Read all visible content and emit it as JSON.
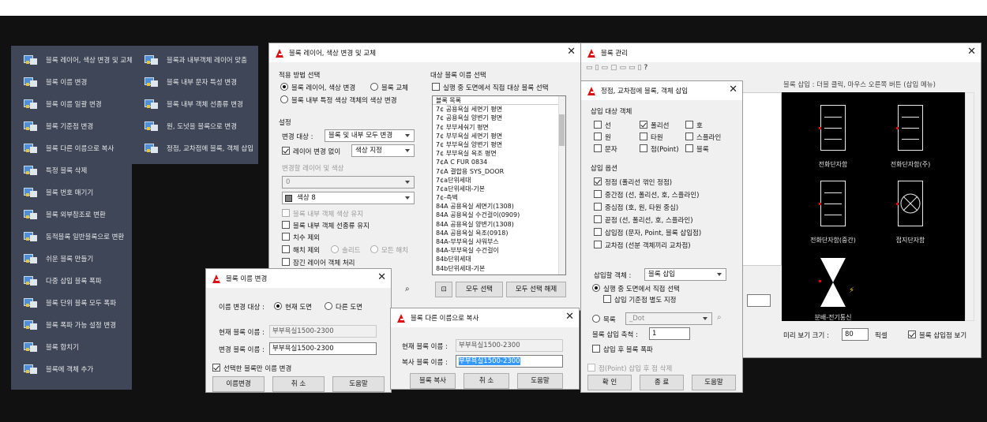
{
  "menu_left": {
    "items": [
      {
        "label": "블록 레이어, 색상 변경 및 교체",
        "icon": "block-layer-icon"
      },
      {
        "label": "블록 이름 변경",
        "icon": "block-rename-icon"
      },
      {
        "label": "블록 이름 일괄 변경",
        "icon": "block-batch-rename-icon"
      },
      {
        "label": "블록 기준점 변경",
        "icon": "block-basepoint-icon"
      },
      {
        "label": "블록 다른 이름으로 복사",
        "icon": "block-copy-icon"
      },
      {
        "label": "특정 블록 삭제",
        "icon": "block-delete-icon"
      },
      {
        "label": "블록 번호 매기기",
        "icon": "block-number-icon"
      },
      {
        "label": "블록 외부참조로 변환",
        "icon": "block-xref-icon"
      },
      {
        "label": "동적블록 일반블록으로 변환",
        "icon": "dynamic-block-icon"
      },
      {
        "label": "쉬운 블록 만들기",
        "icon": "easy-block-icon"
      },
      {
        "label": "다중 삽입 블록 폭파",
        "icon": "multi-insert-explode-icon"
      },
      {
        "label": "블록 단위 블록 모두 폭파",
        "icon": "explode-all-icon"
      },
      {
        "label": "블록 폭파 가능 설정 변경",
        "icon": "explodable-setting-icon"
      },
      {
        "label": "블록 합치기",
        "icon": "block-merge-icon"
      },
      {
        "label": "블록에 객체 추가",
        "icon": "add-object-icon"
      }
    ]
  },
  "menu_right": {
    "items": [
      {
        "label": "블록과 내부객체 레이어 맞춤",
        "icon": "layer-match-icon"
      },
      {
        "label": "블록 내부 문자 특성 변경",
        "icon": "block-text-icon"
      },
      {
        "label": "블록 내부 객체 선종류 변경",
        "icon": "block-linetype-icon"
      },
      {
        "label": "원, 도넛을 블록으로 변경",
        "icon": "circle-to-block-icon"
      },
      {
        "label": "정점, 교차점에 블록, 객체 삽입",
        "icon": "vertex-insert-icon"
      }
    ]
  },
  "dlg_layer": {
    "title": "블록 레이어, 색상 변경 및 교체",
    "close": "✕",
    "apply_header": "적용 방법 선택",
    "radio_layer": "블록 레이어, 색상 변경",
    "radio_replace": "블록 교체",
    "radio_internal": "블록 내부 특정 색상 객체의 색상 변경",
    "settings_header": "설정",
    "change_target_label": "변경 대상 :",
    "change_target_value": "블록 및 내부 모두 변경",
    "no_layer_change": "레이어 변경 없이",
    "color_setting": "색상 지정",
    "layer_color_label": "변경할 레이어 및 색상",
    "layer_value": "0",
    "color_value": "색상 8",
    "keep_internal_color": "블록 내부 객체 색상 유지",
    "keep_linetype": "블록 내부 객체 선종류 유지",
    "exclude_dim": "치수 제외",
    "hatch_exclude": "해치 제외",
    "solid": "솔리드",
    "all_hatch": "모든 해치",
    "locked_layer": "잠긴 레이어 객체 처리",
    "target_header": "대상 블록 이름 선택",
    "select_direct": "실행 중 도면에서 직접 대상 블록 선택",
    "list_header": "블록 목록",
    "blocks": [
      "7¢ 공용욕실 세면기 평면",
      "7¢ 공용욕실 양변기 평면",
      "7¢ 부부세숴기 평면",
      "7¢ 부부욕실 세면기 평면",
      "7¢ 부부욕실 양변기 평면",
      "7¢ 부부욕실 욕조 평면",
      "7¢A C FUR 0834",
      "7¢A 결합용 SYS_DOOR",
      "7¢a단위세대",
      "7¢a단위세대-기본",
      "7¢-측벽",
      "84A 공용욕실 세면기(1308)",
      "84A 공용욕실 수건걸이(0909)",
      "84A 공용욕실 양변기(1308)",
      "84A 공용욕실 욕조(0918)",
      "84A-부부욕실 샤워부스",
      "84A-부부욕실 수건걸이",
      "84b단위세대",
      "84b단위세대-기본"
    ],
    "select_all": "모두 선택",
    "deselect_all": "모두 선택 해제"
  },
  "dlg_rename": {
    "title": "블록 이름 변경",
    "close": "✕",
    "target_label": "이름 변경 대상 :",
    "current_drawing": "현재 도면",
    "other_drawing": "다른 도면",
    "current_name_label": "현재 블록 이름 :",
    "current_name": "부부욕실1500-2300",
    "new_name_label": "변경 블록 이름 :",
    "new_name": "부부욕실1500-2300",
    "only_selected": "선택한 블록만 이름 변경",
    "btn_rename": "이름변경",
    "btn_cancel": "취 소",
    "btn_help": "도움말"
  },
  "dlg_copy": {
    "title": "블록 다른 이름으로 복사",
    "close": "✕",
    "current_label": "현재 블록 이름 :",
    "current_value": "부부욕실1500-2300",
    "copy_label": "복사 블록 이름 :",
    "copy_value": "부부욕실1500-2300",
    "btn_copy": "블록 복사",
    "btn_cancel": "취 소",
    "btn_help": "도움말"
  },
  "dlg_manage": {
    "title": "블록 관리",
    "close": "✕",
    "hint": "블록 삽입 : 더블 클릭, 마우스 오른쪽 버튼 (삽입 메뉴)",
    "blocks": [
      "전화단자함",
      "전화단자함(주)",
      "전화단자함(중간)",
      "접지단자함",
      "분배-전기통신"
    ],
    "preview_size_label": "미리 보기 크기 :",
    "preview_size_value": "80",
    "unit": "픽셀",
    "show_insert": "블록 삽입점 보기",
    "toolbar_help": "?"
  },
  "dlg_vertex": {
    "title": "정점, 교차점에 블록, 객체 삽입",
    "close": "✕",
    "target_header": "삽입 대상 객체",
    "obj": [
      "선",
      "폴리선",
      "호",
      "원",
      "타원",
      "스플라인",
      "문자",
      "점(Point)",
      "블록"
    ],
    "options_header": "삽입 옵션",
    "opt": [
      "정점 (폴리선 꺾인 정점)",
      "중간점 (선, 폴리선, 호, 스플라인)",
      "중심점 (호, 원, 타원 중심)",
      "끝점 (선, 폴리선, 호, 스플라인)",
      "삽입점 (문자, Point, 블록 삽입점)",
      "교차점 (선분 객체끼리 교차점)"
    ],
    "insert_obj_label": "삽입할 객체 :",
    "insert_obj_value": "블록 삽입",
    "select_in_drawing": "실행 중 도면에서 직접 선택",
    "separate_base": "삽입 기준점 별도 지정",
    "list_label": "목록",
    "list_value": "_Dot",
    "scale_label": "블록 삽입 축척 :",
    "scale_value": "1",
    "explode_after": "삽입 후 블록 폭파",
    "delete_point": "점(Point) 삽입 후 점 삭제",
    "btn_ok": "확 인",
    "btn_end": "종 료",
    "btn_help": "도움말"
  }
}
